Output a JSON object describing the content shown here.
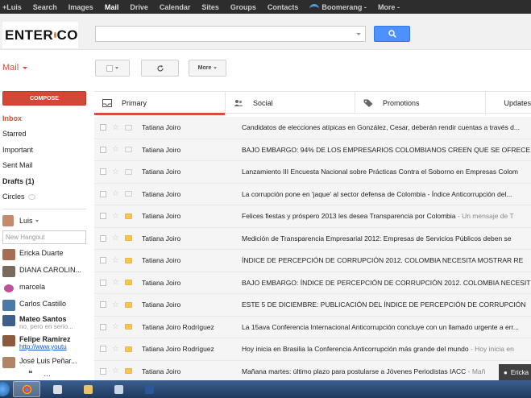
{
  "topbar": {
    "items": [
      "+Luis",
      "Search",
      "Images",
      "Mail",
      "Drive",
      "Calendar",
      "Sites",
      "Groups",
      "Contacts",
      "Boomerang -",
      "More -"
    ],
    "active": "Mail"
  },
  "logo": {
    "text_left": "ENTER",
    "text_right": "CO"
  },
  "mail_label": "Mail",
  "toolbar": {
    "more_label": "More"
  },
  "sidebar": {
    "compose_label": "COMPOSE",
    "nav": [
      "Inbox",
      "Starred",
      "Important",
      "Sent Mail",
      "Drafts (1)",
      "Circles"
    ],
    "hangout_user": "Luis",
    "new_hangout_placeholder": "New Hangout",
    "contacts": [
      {
        "name": "Ericka Duarte",
        "sub": ""
      },
      {
        "name": "DIANA CAROLIN...",
        "sub": ""
      },
      {
        "name": "marcela",
        "sub": ""
      },
      {
        "name": "Carlos Castillo",
        "sub": ""
      },
      {
        "name": "Mateo Santos",
        "sub": "no, pero en serio..."
      },
      {
        "name": "Felipe Ramirez",
        "sub": "http://www.youtu"
      },
      {
        "name": "José Luis Peñar...",
        "sub": ""
      }
    ],
    "footer_more": "..."
  },
  "tabs": [
    "Primary",
    "Social",
    "Promotions",
    "Updates"
  ],
  "emails": [
    {
      "sender": "Tatiana Joiro",
      "subject": "Candidatos de elecciones atípicas en González, Cesar, deberán rendir cuentas a través d...",
      "snippet": "",
      "important": false
    },
    {
      "sender": "Tatiana Joiro",
      "subject": "BAJO EMBARGO: 94% DE LOS EMPRESARIOS COLOMBIANOS CREEN QUE SE OFRECE",
      "snippet": "",
      "important": false
    },
    {
      "sender": "Tatiana Joiro",
      "subject": "Lanzamiento III Encuesta Nacional sobre Prácticas Contra el Soborno en Empresas Colom",
      "snippet": "",
      "important": false
    },
    {
      "sender": "Tatiana Joiro",
      "subject": "La corrupción pone en 'jaque' al sector defensa de Colombia - Índice Anticorrupción del...",
      "snippet": "",
      "important": false
    },
    {
      "sender": "Tatiana Joiro",
      "subject": "Felices fiestas y próspero 2013 les desea Transparencia por Colombia",
      "snippet": " - Un mensaje de T",
      "important": true
    },
    {
      "sender": "Tatiana Joiro",
      "subject": "Medición de Transparencia Empresarial 2012: Empresas de Servicios Públicos deben se",
      "snippet": "",
      "important": true
    },
    {
      "sender": "Tatiana Joiro",
      "subject": "ÍNDICE DE PERCEPCIÓN DE CORRUPCIÓN 2012. COLOMBIA NECESITA MOSTRAR RE",
      "snippet": "",
      "important": true
    },
    {
      "sender": "Tatiana Joiro",
      "subject": "BAJO EMBARGO: ÍNDICE DE PERCEPCIÓN DE CORRUPCIÓN 2012. COLOMBIA NECESIT",
      "snippet": "",
      "important": true
    },
    {
      "sender": "Tatiana Joiro",
      "subject": "ESTE 5 DE DICIEMBRE: PUBLICACIÓN DEL ÍNDICE DE PERCEPCIÓN DE CORRUPCIÓN",
      "snippet": "",
      "important": true
    },
    {
      "sender": "Tatiana Joiro Rodríguez",
      "subject": "La 15ava Conferencia Internacional Anticorrupción concluye con un llamado urgente a err...",
      "snippet": "",
      "important": true
    },
    {
      "sender": "Tatiana Joiro Rodríguez",
      "subject": "Hoy inicia en Brasilia la Conferencia Anticorrupción más grande del mundo",
      "snippet": " - Hoy inicia en",
      "important": true
    },
    {
      "sender": "Tatiana Joiro",
      "subject": "Mañana martes: último plazo para postularse a Jóvenes Periodistas IACC",
      "snippet": " - Mañ",
      "important": true
    }
  ],
  "chat_popup": "Ericka",
  "colors": {
    "topbar": "#2d2d2d",
    "compose": "#d14836",
    "search_button": "#4d90fe",
    "important": "#f9c64b",
    "mail_label": "#dd4b39"
  }
}
